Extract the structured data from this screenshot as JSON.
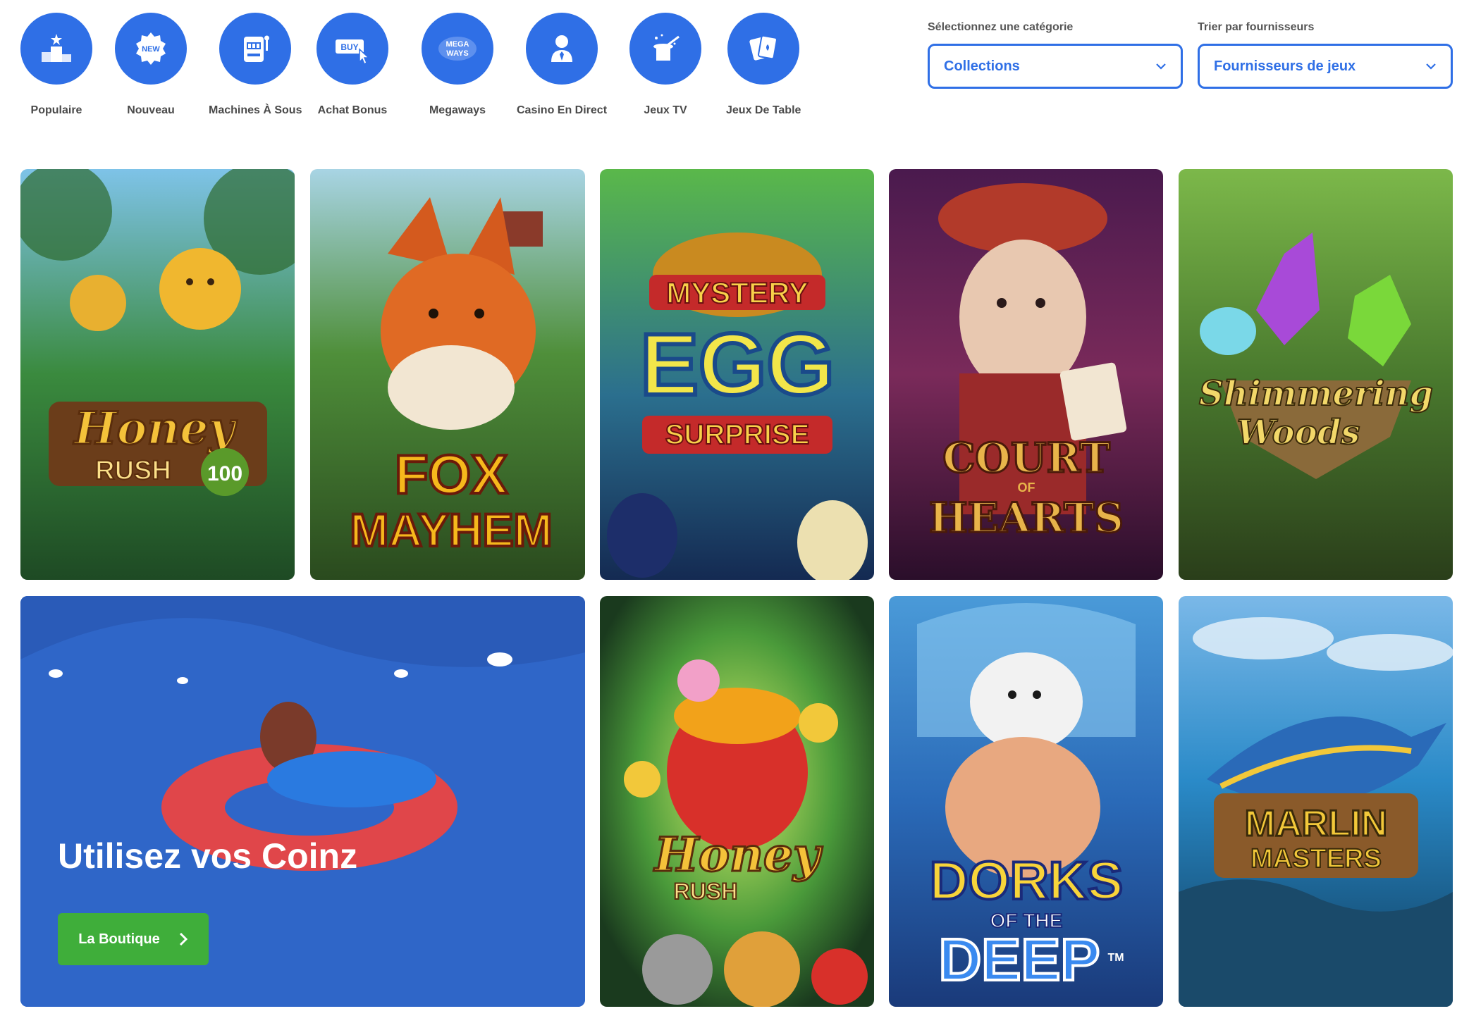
{
  "categories": [
    {
      "label": "Populaire",
      "icon": "podium-icon"
    },
    {
      "label": "Nouveau",
      "icon": "new-badge-icon"
    },
    {
      "label": "Machines À Sous",
      "icon": "slot-machine-icon"
    },
    {
      "label": "Achat Bonus",
      "icon": "buy-cursor-icon"
    },
    {
      "label": "Megaways",
      "icon": "megaways-icon",
      "icon_text": "MEGA WAYS"
    },
    {
      "label": "Casino En Direct",
      "icon": "dealer-icon"
    },
    {
      "label": "Jeux TV",
      "icon": "magic-hat-icon"
    },
    {
      "label": "Jeux De Table",
      "icon": "cards-icon"
    }
  ],
  "icon_texts": {
    "new": "NEW",
    "buy": "BUY",
    "mega": "MEGA",
    "ways": "WAYS"
  },
  "filters": {
    "category": {
      "label": "Sélectionnez une catégorie",
      "value": "Collections"
    },
    "provider": {
      "label": "Trier par fournisseurs",
      "value": "Fournisseurs de jeux"
    }
  },
  "games": [
    {
      "title_line1": "Honey",
      "title_line2": "RUSH",
      "badge": "100"
    },
    {
      "title_line1": "FOX",
      "title_line2": "MAYHEM"
    },
    {
      "title_line1": "MYSTERY",
      "title_line2": "EGG",
      "title_line3": "SURPRISE"
    },
    {
      "title_line1": "COURT",
      "title_line2": "OF",
      "title_line3": "HEARTS"
    },
    {
      "title_line1": "Shimmering",
      "title_line2": "Woods"
    },
    {
      "title_line1": "Honey",
      "title_line2": "RUSH"
    },
    {
      "title_line1": "DORKS",
      "title_line2": "OF THE",
      "title_line3": "DEEP",
      "tm": "TM"
    },
    {
      "title_line1": "MARLIN",
      "title_line2": "MASTERS"
    }
  ],
  "promo": {
    "title": "Utilisez vos Coinz",
    "button_label": "La Boutique"
  },
  "colors": {
    "accent": "#2f6fe6",
    "button_green": "#3fae3a",
    "promo_bg": "#2f66c8"
  }
}
